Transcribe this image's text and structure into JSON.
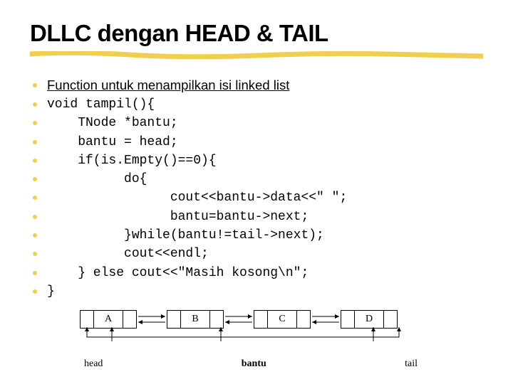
{
  "title": "DLLC dengan HEAD & TAIL",
  "lines": [
    {
      "kind": "heading",
      "text": "Function untuk menampilkan isi linked list"
    },
    {
      "kind": "code",
      "text": "void tampil(){"
    },
    {
      "kind": "code",
      "text": "    TNode *bantu;"
    },
    {
      "kind": "code",
      "text": "    bantu = head;"
    },
    {
      "kind": "code",
      "text": "    if(is.Empty()==0){"
    },
    {
      "kind": "code",
      "text": "          do{"
    },
    {
      "kind": "code",
      "text": "                cout<<bantu->data<<\" \";"
    },
    {
      "kind": "code",
      "text": "                bantu=bantu->next;"
    },
    {
      "kind": "code",
      "text": "          }while(bantu!=tail->next);"
    },
    {
      "kind": "code",
      "text": "          cout<<endl;"
    },
    {
      "kind": "code",
      "text": "    } else cout<<\"Masih kosong\\n\";"
    },
    {
      "kind": "code",
      "text": "}"
    }
  ],
  "diagram": {
    "nodes": [
      "A",
      "B",
      "C",
      "D"
    ],
    "labels": [
      "head",
      "bantu",
      "tail"
    ]
  }
}
